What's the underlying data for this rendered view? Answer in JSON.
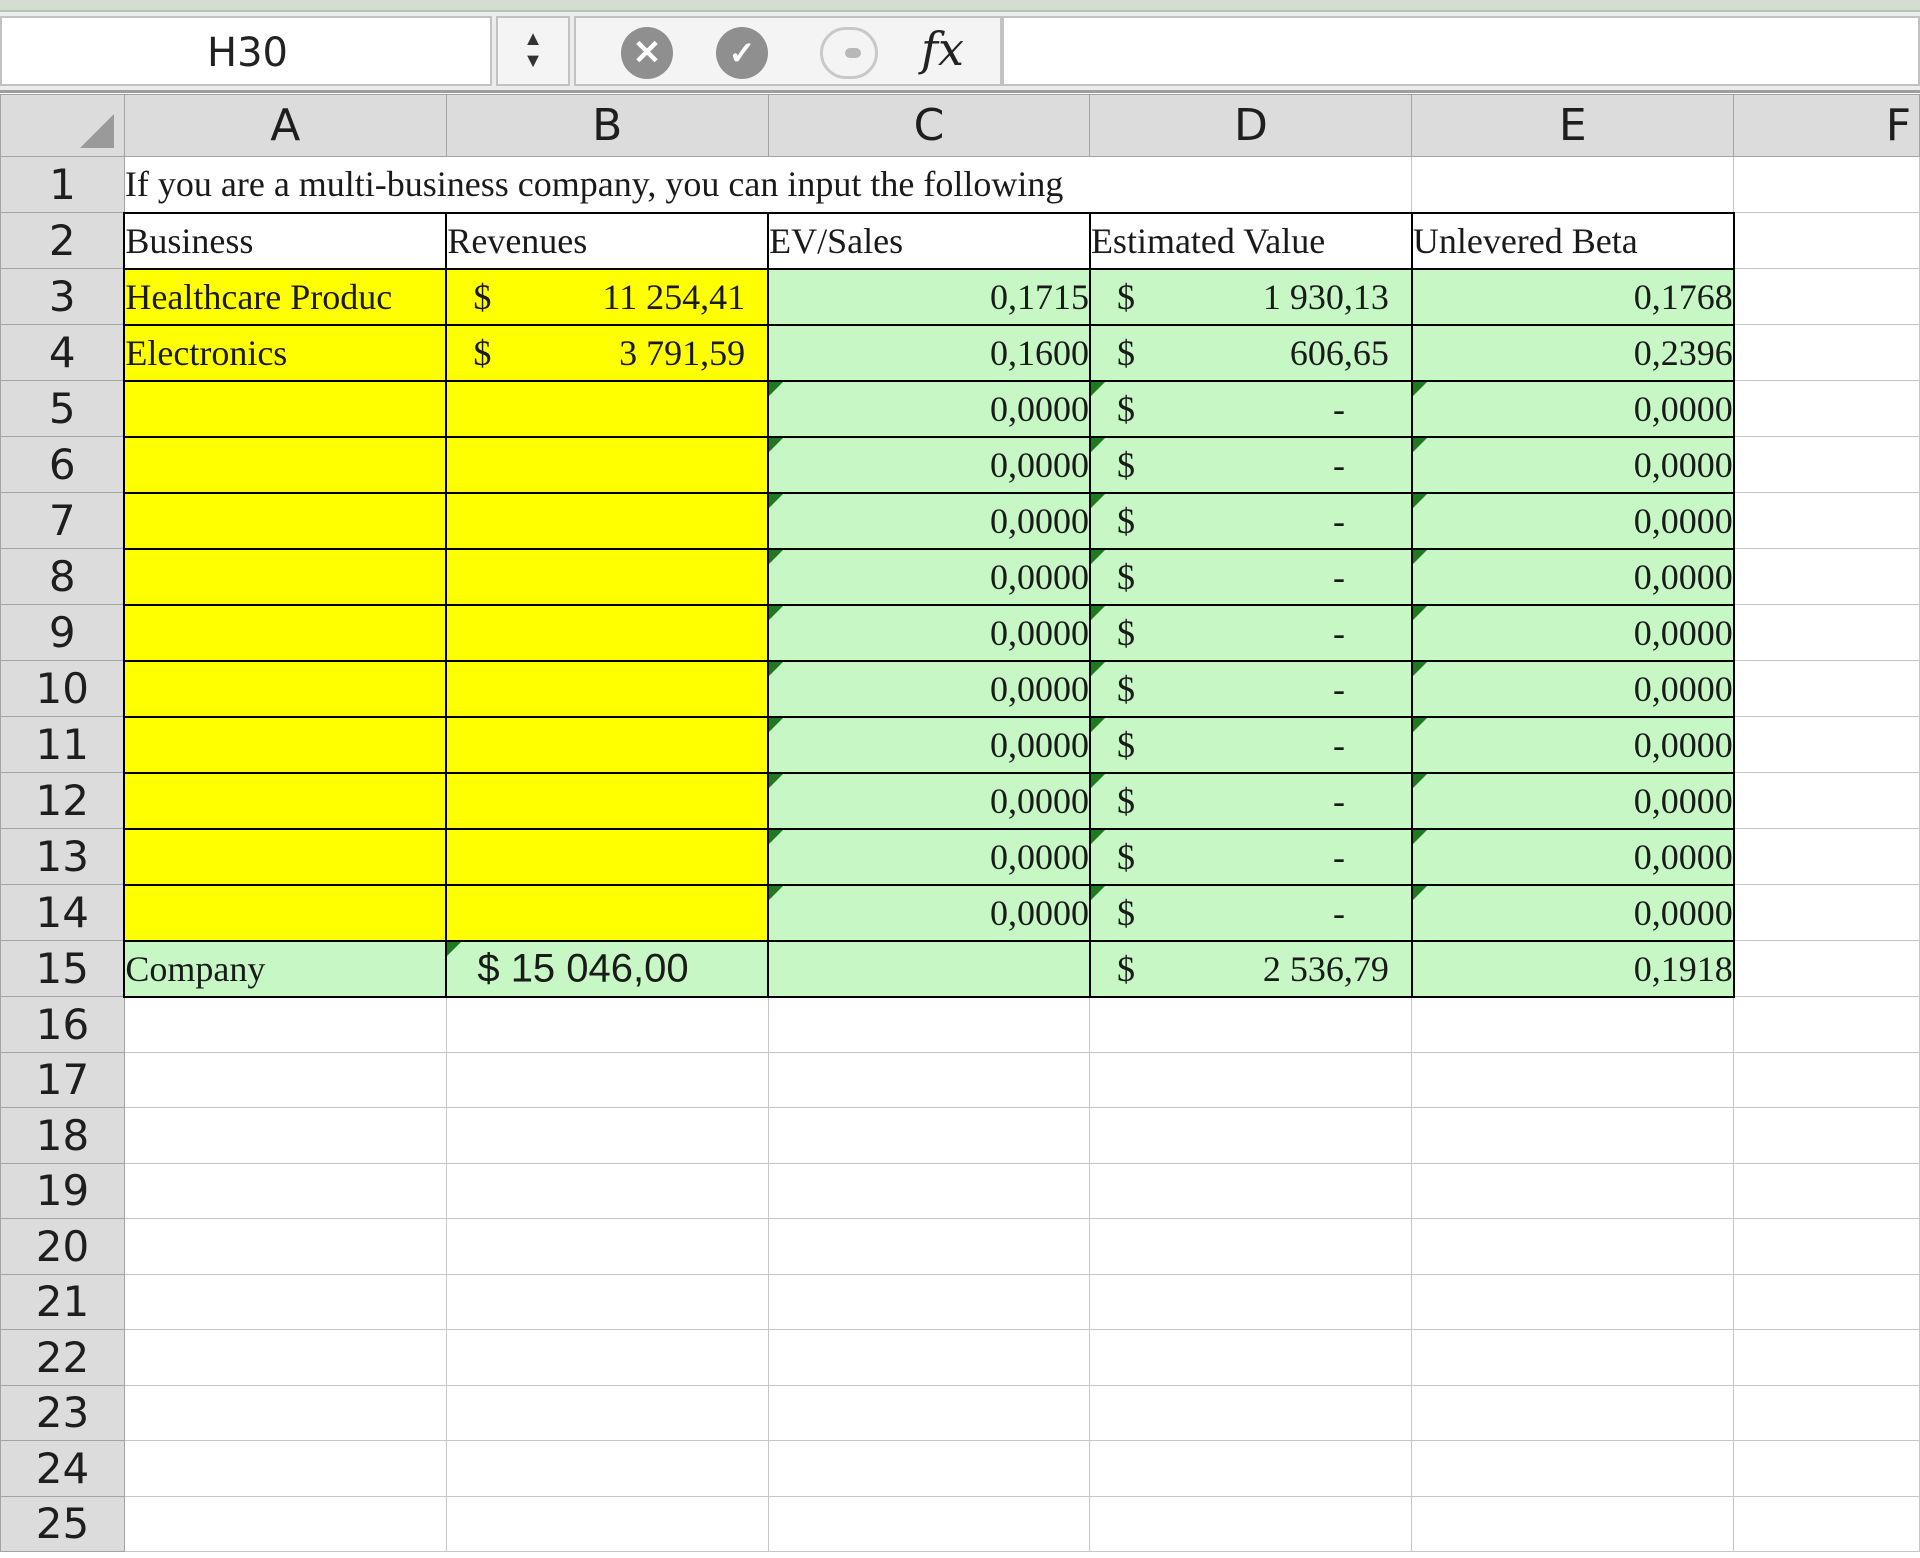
{
  "formula_bar": {
    "name_box": "H30",
    "stepper_up": "▲",
    "stepper_down": "▼",
    "cancel_glyph": "✕",
    "enter_glyph": "✓",
    "fx_label": "fx",
    "formula": ""
  },
  "columns": [
    "A",
    "B",
    "C",
    "D",
    "E",
    "F"
  ],
  "rows": [
    "1",
    "2",
    "3",
    "4",
    "5",
    "6",
    "7",
    "8",
    "9",
    "10",
    "11",
    "12",
    "13",
    "14",
    "15",
    "16",
    "17",
    "18",
    "19",
    "20",
    "21",
    "22",
    "23",
    "24",
    "25"
  ],
  "cells": {
    "A1": "If you are a multi-business company, you can input the following",
    "A2": "Business",
    "B2": "Revenues",
    "C2": "EV/Sales",
    "D2": "Estimated Value",
    "E2": "Unlevered Beta",
    "A3": "Healthcare Produc",
    "B3": {
      "currency": "$",
      "value": "11 254,41"
    },
    "C3": "0,1715",
    "D3": {
      "currency": "$",
      "value": "1 930,13"
    },
    "E3": "0,1768",
    "A4": "Electronics",
    "B4": {
      "currency": "$",
      "value": "3 791,59"
    },
    "C4": "0,1600",
    "D4": {
      "currency": "$",
      "value": "606,65"
    },
    "E4": "0,2396",
    "C5": "0,0000",
    "D5": {
      "currency": "$",
      "value": "-"
    },
    "E5": "0,0000",
    "C6": "0,0000",
    "D6": {
      "currency": "$",
      "value": "-"
    },
    "E6": "0,0000",
    "C7": "0,0000",
    "D7": {
      "currency": "$",
      "value": "-"
    },
    "E7": "0,0000",
    "C8": "0,0000",
    "D8": {
      "currency": "$",
      "value": "-"
    },
    "E8": "0,0000",
    "C9": "0,0000",
    "D9": {
      "currency": "$",
      "value": "-"
    },
    "E9": "0,0000",
    "C10": "0,0000",
    "D10": {
      "currency": "$",
      "value": "-"
    },
    "E10": "0,0000",
    "C11": "0,0000",
    "D11": {
      "currency": "$",
      "value": "-"
    },
    "E11": "0,0000",
    "C12": "0,0000",
    "D12": {
      "currency": "$",
      "value": "-"
    },
    "E12": "0,0000",
    "C13": "0,0000",
    "D13": {
      "currency": "$",
      "value": "-"
    },
    "E13": "0,0000",
    "C14": "0,0000",
    "D14": {
      "currency": "$",
      "value": "-"
    },
    "E14": "0,0000",
    "A15": "Company",
    "B15": "$ 15  046,00",
    "D15": {
      "currency": "$",
      "value": "2 536,79"
    },
    "E15": "0,1918"
  },
  "colors": {
    "input_yellow": "#ffff00",
    "calc_green": "#c6f7c5",
    "error_indicator": "#1f7a1f",
    "header_gray": "#dcdcdc"
  }
}
